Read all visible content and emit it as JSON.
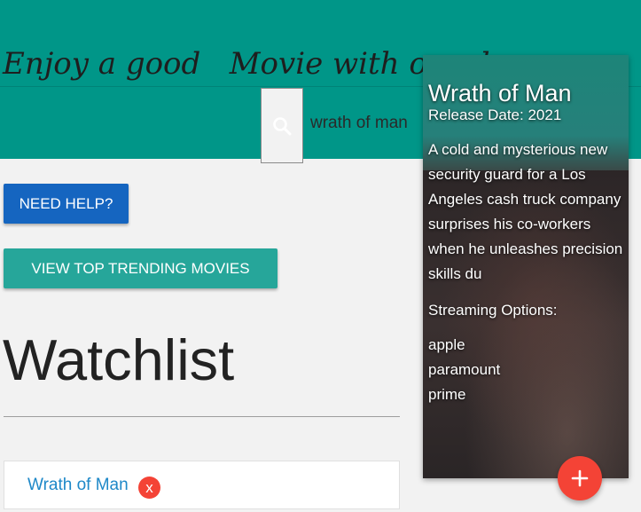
{
  "header": {
    "tagline": "Enjoy a good   Movie with our d",
    "search_value": "wrath of man"
  },
  "buttons": {
    "help": "NEED HELP?",
    "trending": "VIEW TOP TRENDING MOVIES"
  },
  "watchlist": {
    "title": "Watchlist",
    "items": [
      {
        "label": "Wrath of Man",
        "remove": "x"
      }
    ]
  },
  "movie_card": {
    "title": "Wrath of Man",
    "release": "Release Date: 2021",
    "description": "A cold and mysterious new security guard for a Los Angeles cash truck company surprises his co-workers when he unleashes precision skills du",
    "streaming_label": "Streaming Options:",
    "providers": [
      "apple",
      "paramount",
      "prime"
    ]
  },
  "colors": {
    "header": "#009688",
    "help_button": "#1565c0",
    "trending_button": "#26a69a",
    "accent_red": "#f44336",
    "link": "#1e88c8"
  },
  "icons": {
    "search": "search-icon",
    "add": "plus-icon",
    "remove": "close-icon"
  }
}
